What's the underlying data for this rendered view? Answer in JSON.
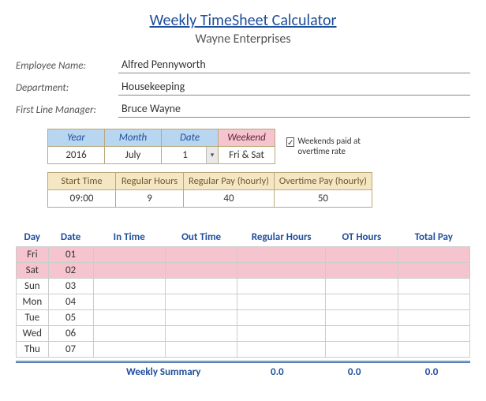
{
  "title": "Weekly TimeSheet Calculator",
  "company": "Wayne Enterprises",
  "info": {
    "employee_label": "Employee Name:",
    "employee": "Alfred Pennyworth",
    "department_label": "Department:",
    "department": "Housekeeping",
    "manager_label": "First Line Manager:",
    "manager": "Bruce Wayne"
  },
  "selectors": {
    "year_h": "Year",
    "year": "2016",
    "month_h": "Month",
    "month": "July",
    "date_h": "Date",
    "date": "1",
    "weekend_h": "Weekend",
    "weekend": "Fri & Sat"
  },
  "checkbox": {
    "checked_glyph": "✓",
    "label": "Weekends paid at overtime rate"
  },
  "pay": {
    "start_h": "Start Time",
    "start": "09:00",
    "regh_h": "Regular Hours",
    "regh": "9",
    "regpay_h": "Regular Pay (hourly)",
    "regpay": "40",
    "otpay_h": "Overtime Pay (hourly)",
    "otpay": "50"
  },
  "main_headers": [
    "Day",
    "Date",
    "In Time",
    "Out Time",
    "Regular Hours",
    "OT Hours",
    "Total Pay"
  ],
  "rows": [
    {
      "day": "Fri",
      "date": "01",
      "weekend": true
    },
    {
      "day": "Sat",
      "date": "02",
      "weekend": true
    },
    {
      "day": "Sun",
      "date": "03",
      "weekend": false
    },
    {
      "day": "Mon",
      "date": "04",
      "weekend": false
    },
    {
      "day": "Tue",
      "date": "05",
      "weekend": false
    },
    {
      "day": "Wed",
      "date": "06",
      "weekend": false
    },
    {
      "day": "Thu",
      "date": "07",
      "weekend": false
    }
  ],
  "summary": {
    "label": "Weekly Summary",
    "reg": "0.0",
    "ot": "0.0",
    "total": "0.0"
  }
}
